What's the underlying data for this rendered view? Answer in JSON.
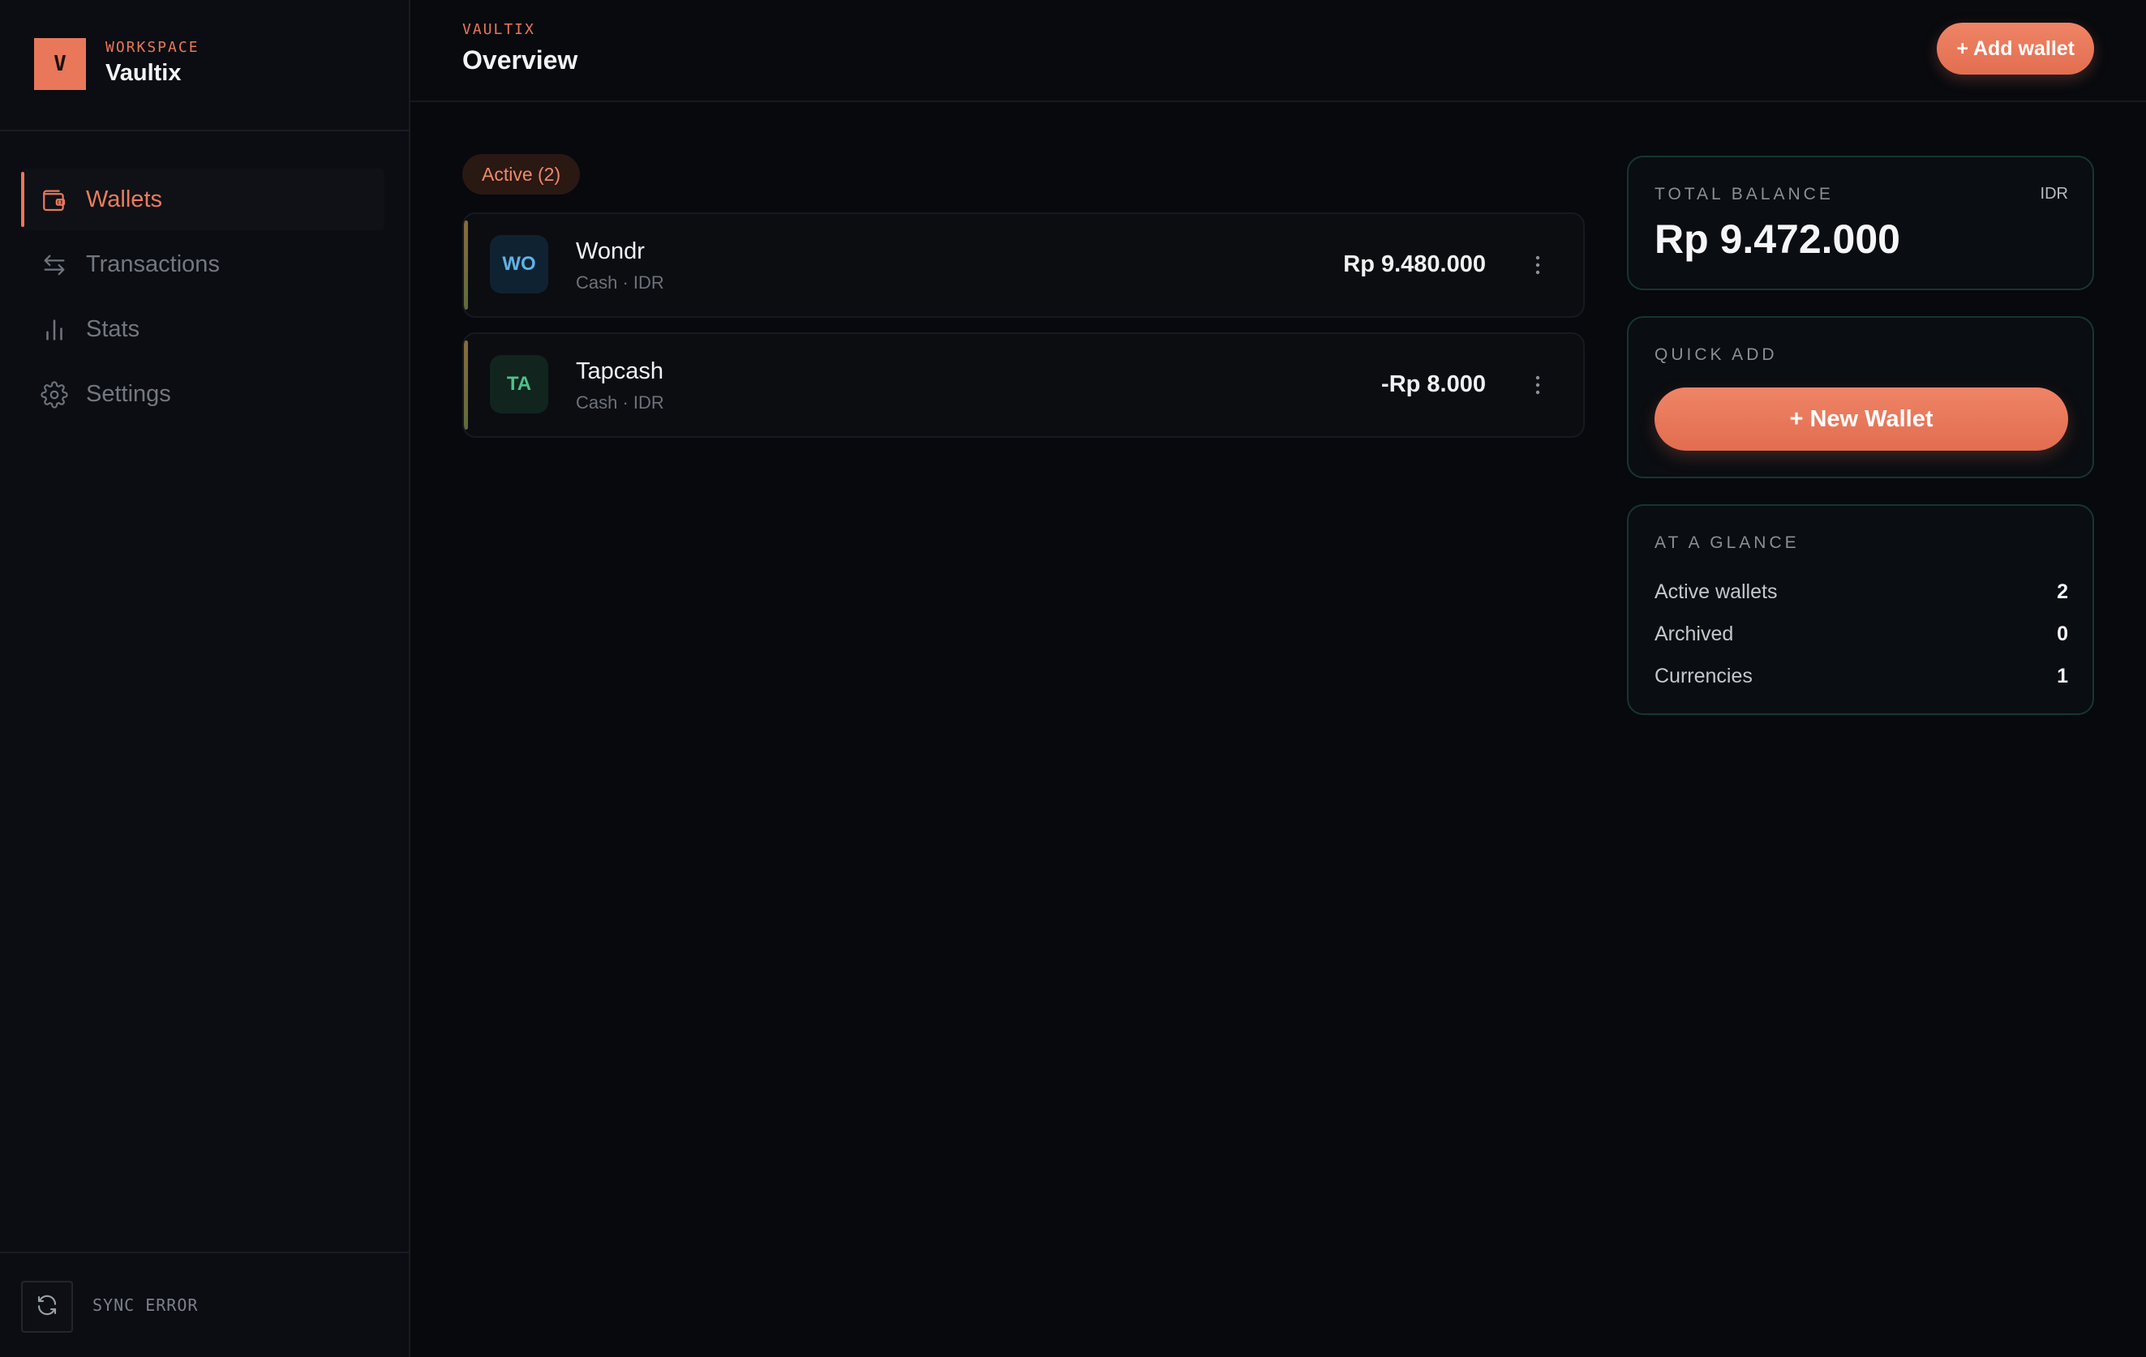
{
  "brand": {
    "logo_letter": "V",
    "kicker": "WORKSPACE",
    "name": "Vaultix"
  },
  "sidebar": {
    "items": [
      {
        "label": "Wallets",
        "icon": "wallet-icon",
        "active": true
      },
      {
        "label": "Transactions",
        "icon": "transfer-arrows-icon",
        "active": false
      },
      {
        "label": "Stats",
        "icon": "bar-chart-icon",
        "active": false
      },
      {
        "label": "Settings",
        "icon": "gear-icon",
        "active": false
      }
    ],
    "sync_status": "SYNC ERROR"
  },
  "header": {
    "kicker": "VAULTIX",
    "title": "Overview",
    "add_wallet_label": "+ Add wallet"
  },
  "filter": {
    "label": "Active (2)"
  },
  "wallets": [
    {
      "initials": "WO",
      "name": "Wondr",
      "meta": "Cash · IDR",
      "balance": "Rp 9.480.000",
      "avatar_bg": "#0f2231",
      "avatar_fg": "#5fb2e6"
    },
    {
      "initials": "TA",
      "name": "Tapcash",
      "meta": "Cash · IDR",
      "balance": "-Rp 8.000",
      "avatar_bg": "#11241e",
      "avatar_fg": "#4fc089"
    }
  ],
  "total_balance": {
    "title": "TOTAL BALANCE",
    "currency": "IDR",
    "value": "Rp 9.472.000"
  },
  "quick_add": {
    "title": "QUICK ADD",
    "button_label": "+ New Wallet"
  },
  "glance": {
    "title": "AT A GLANCE",
    "stats": [
      {
        "label": "Active wallets",
        "value": "2"
      },
      {
        "label": "Archived",
        "value": "0"
      },
      {
        "label": "Currencies",
        "value": "1"
      }
    ]
  },
  "colors": {
    "accent": "#e9775a",
    "panel_border": "#173532",
    "background": "#07090d"
  }
}
